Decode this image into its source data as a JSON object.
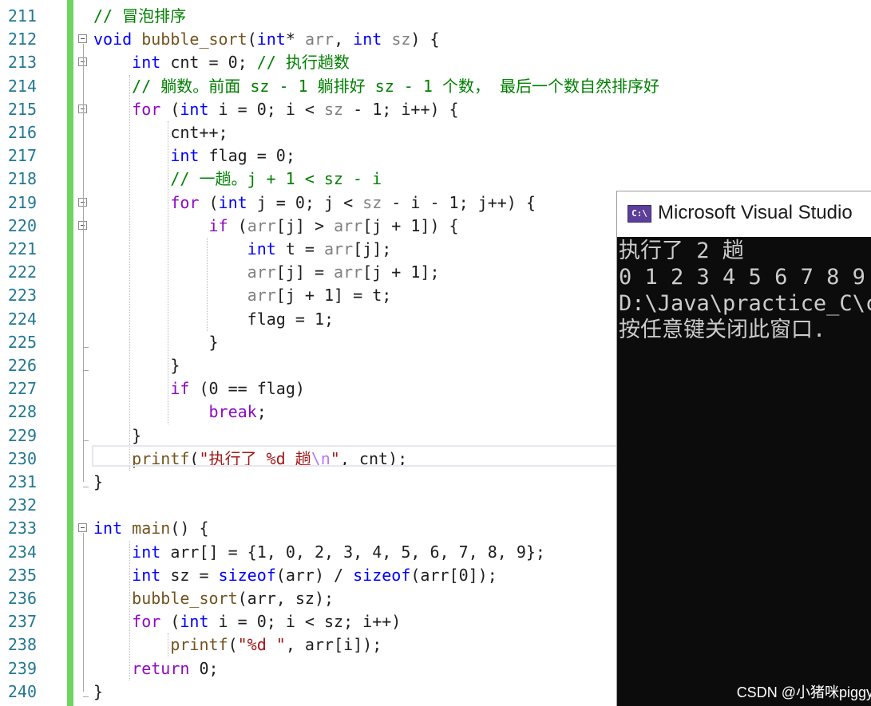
{
  "editor": {
    "lines": [
      {
        "n": "211",
        "t": [
          [
            "cm",
            "// 冒泡排序"
          ]
        ]
      },
      {
        "n": "212",
        "t": [
          [
            "kw",
            "void"
          ],
          [
            "",
            " "
          ],
          [
            "fn",
            "bubble_sort"
          ],
          [
            "",
            "("
          ],
          [
            "kw",
            "int"
          ],
          [
            "",
            "* "
          ],
          [
            "pr",
            "arr"
          ],
          [
            "",
            ", "
          ],
          [
            "kw",
            "int"
          ],
          [
            "",
            " "
          ],
          [
            "pr",
            "sz"
          ],
          [
            "",
            ") {"
          ]
        ]
      },
      {
        "n": "213",
        "t": [
          [
            "",
            "    "
          ],
          [
            "kw",
            "int"
          ],
          [
            "",
            " cnt = 0; "
          ],
          [
            "cm",
            "// 执行趟数"
          ]
        ]
      },
      {
        "n": "214",
        "t": [
          [
            "",
            "    "
          ],
          [
            "cm",
            "// 躺数。前面 sz - 1 躺排好 sz - 1 个数， 最后一个数自然排序好"
          ]
        ]
      },
      {
        "n": "215",
        "t": [
          [
            "",
            "    "
          ],
          [
            "kwc",
            "for"
          ],
          [
            "",
            " ("
          ],
          [
            "kw",
            "int"
          ],
          [
            "",
            " i = 0; i < "
          ],
          [
            "pr",
            "sz"
          ],
          [
            "",
            " - 1; i++) {"
          ]
        ]
      },
      {
        "n": "216",
        "t": [
          [
            "",
            "        cnt++;"
          ]
        ]
      },
      {
        "n": "217",
        "t": [
          [
            "",
            "        "
          ],
          [
            "kw",
            "int"
          ],
          [
            "",
            " flag = 0;"
          ]
        ]
      },
      {
        "n": "218",
        "t": [
          [
            "",
            "        "
          ],
          [
            "cm",
            "// 一趟。j + 1 < sz - i"
          ]
        ]
      },
      {
        "n": "219",
        "t": [
          [
            "",
            "        "
          ],
          [
            "kwc",
            "for"
          ],
          [
            "",
            " ("
          ],
          [
            "kw",
            "int"
          ],
          [
            "",
            " j = 0; j < "
          ],
          [
            "pr",
            "sz"
          ],
          [
            "",
            " - i - 1; j++) {"
          ]
        ]
      },
      {
        "n": "220",
        "t": [
          [
            "",
            "            "
          ],
          [
            "kwc",
            "if"
          ],
          [
            "",
            " ("
          ],
          [
            "pr",
            "arr"
          ],
          [
            "",
            "[j] > "
          ],
          [
            "pr",
            "arr"
          ],
          [
            "",
            "[j + 1]) {"
          ]
        ]
      },
      {
        "n": "221",
        "t": [
          [
            "",
            "                "
          ],
          [
            "kw",
            "int"
          ],
          [
            "",
            " t = "
          ],
          [
            "pr",
            "arr"
          ],
          [
            "",
            "[j];"
          ]
        ]
      },
      {
        "n": "222",
        "t": [
          [
            "",
            "                "
          ],
          [
            "pr",
            "arr"
          ],
          [
            "",
            "[j] = "
          ],
          [
            "pr",
            "arr"
          ],
          [
            "",
            "[j + 1];"
          ]
        ]
      },
      {
        "n": "223",
        "t": [
          [
            "",
            "                "
          ],
          [
            "pr",
            "arr"
          ],
          [
            "",
            "[j + 1] = t;"
          ]
        ]
      },
      {
        "n": "224",
        "t": [
          [
            "",
            "                flag = 1;"
          ]
        ]
      },
      {
        "n": "225",
        "t": [
          [
            "",
            "            }"
          ]
        ]
      },
      {
        "n": "226",
        "t": [
          [
            "",
            "        }"
          ]
        ]
      },
      {
        "n": "227",
        "t": [
          [
            "",
            "        "
          ],
          [
            "kwc",
            "if"
          ],
          [
            "",
            " (0 == flag)"
          ]
        ]
      },
      {
        "n": "228",
        "t": [
          [
            "",
            "            "
          ],
          [
            "kwc",
            "break"
          ],
          [
            "",
            ";"
          ]
        ]
      },
      {
        "n": "229",
        "t": [
          [
            "",
            "    }"
          ]
        ]
      },
      {
        "n": "230",
        "t": [
          [
            "",
            "    "
          ],
          [
            "fn",
            "printf"
          ],
          [
            "",
            "("
          ],
          [
            "st",
            "\"执行了 %d 趟"
          ],
          [
            "esc",
            "\\n"
          ],
          [
            "st",
            "\""
          ],
          [
            "",
            ", cnt);"
          ]
        ]
      },
      {
        "n": "231",
        "t": [
          [
            "",
            "}"
          ]
        ]
      },
      {
        "n": "232",
        "t": []
      },
      {
        "n": "233",
        "t": [
          [
            "kw",
            "int"
          ],
          [
            "",
            " "
          ],
          [
            "fn",
            "main"
          ],
          [
            "",
            "() {"
          ]
        ]
      },
      {
        "n": "234",
        "t": [
          [
            "",
            "    "
          ],
          [
            "kw",
            "int"
          ],
          [
            "",
            " arr[] = {1, 0, 2, 3, 4, 5, 6, 7, 8, 9};"
          ]
        ]
      },
      {
        "n": "235",
        "t": [
          [
            "",
            "    "
          ],
          [
            "kw",
            "int"
          ],
          [
            "",
            " sz = "
          ],
          [
            "kw",
            "sizeof"
          ],
          [
            "",
            "(arr) / "
          ],
          [
            "kw",
            "sizeof"
          ],
          [
            "",
            "(arr[0]);"
          ]
        ]
      },
      {
        "n": "236",
        "t": [
          [
            "",
            "    "
          ],
          [
            "fn",
            "bubble_sort"
          ],
          [
            "",
            "(arr, sz);"
          ]
        ]
      },
      {
        "n": "237",
        "t": [
          [
            "",
            "    "
          ],
          [
            "kwc",
            "for"
          ],
          [
            "",
            " ("
          ],
          [
            "kw",
            "int"
          ],
          [
            "",
            " i = 0; i < sz; i++)"
          ]
        ]
      },
      {
        "n": "238",
        "t": [
          [
            "",
            "        "
          ],
          [
            "fn",
            "printf"
          ],
          [
            "",
            "("
          ],
          [
            "st",
            "\"%d \""
          ],
          [
            "",
            ", arr[i]);"
          ]
        ]
      },
      {
        "n": "239",
        "t": [
          [
            "",
            "    "
          ],
          [
            "kwc",
            "return"
          ],
          [
            "",
            " 0;"
          ]
        ]
      },
      {
        "n": "240",
        "t": [
          [
            "",
            "}"
          ]
        ]
      }
    ]
  },
  "console": {
    "icon_text": "C:\\",
    "title": "Microsoft Visual Studio",
    "output": [
      "执行了 2 趟",
      "0 1 2 3 4 5 6 7 8 9",
      "D:\\Java\\practice_C\\c",
      "按任意键关闭此窗口."
    ]
  },
  "watermark": "CSDN @小猪咪piggy"
}
